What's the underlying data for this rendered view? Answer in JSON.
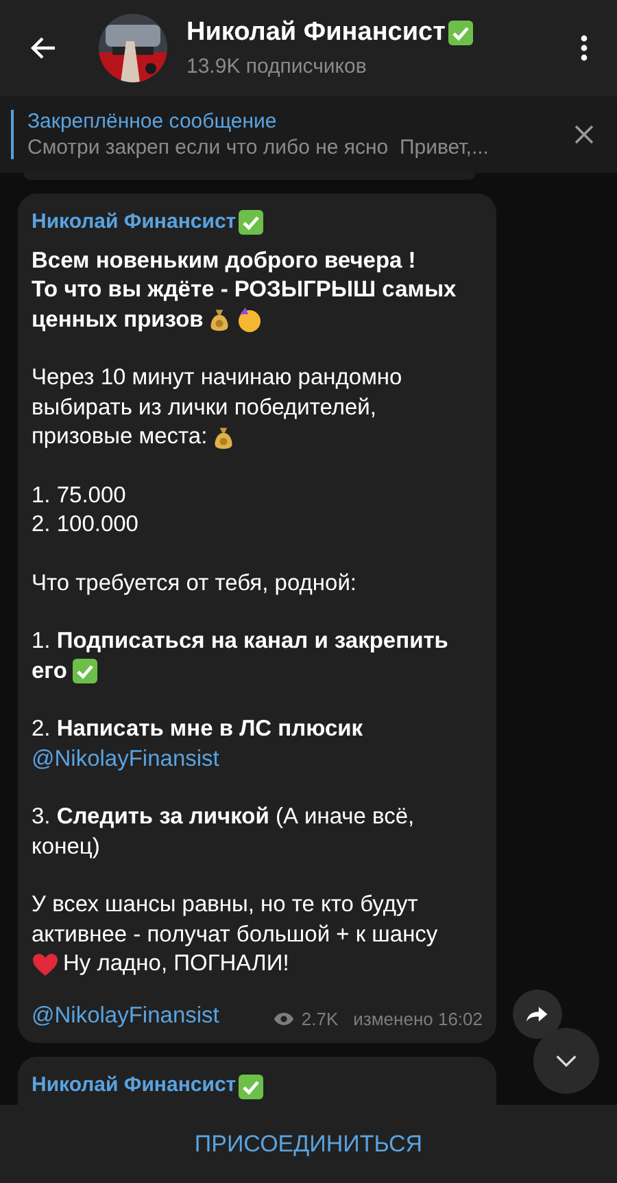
{
  "header": {
    "title": "Николай Финансист",
    "verified": true,
    "subtitle": "13.9K подписчиков"
  },
  "pinned": {
    "title": "Закреплённое сообщение",
    "text": "Смотри закреп если что либо не ясно  Привет,..."
  },
  "messages": [
    {
      "author": "Николай Финансист",
      "verified": true,
      "paragraphs": [
        [
          [
            {
              "kind": "text",
              "text": "Всем новеньким доброго вечера !\nТо что вы ждёте - РОЗЫГРЫШ самых",
              "bold": true
            }
          ],
          [
            {
              "kind": "text",
              "text": "ценных призов",
              "bold": true
            },
            {
              "kind": "moneybag"
            },
            {
              "kind": "party"
            }
          ]
        ],
        [
          [
            {
              "kind": "text",
              "text": "Через 10 минут начинаю рандомно\nвыбирать из лички победителей,",
              "bold": false
            }
          ],
          [
            {
              "kind": "text",
              "text": "призовые места:",
              "bold": false
            },
            {
              "kind": "moneybag"
            }
          ]
        ],
        [
          [
            {
              "kind": "text",
              "text": "1. 75.000\n2. 100.000",
              "bold": false
            }
          ]
        ],
        [
          [
            {
              "kind": "text",
              "text": "Что требуется от тебя, родной:",
              "bold": false
            }
          ]
        ],
        [
          [
            {
              "kind": "text",
              "text": "1. **Подписаться на канал и закрепить**",
              "bold": false
            }
          ],
          [
            {
              "kind": "text",
              "text": "его",
              "bold": true
            },
            {
              "kind": "check"
            }
          ]
        ],
        [
          [
            {
              "kind": "text",
              "text": "2. **Написать мне в ЛС плюсик**",
              "bold": false
            }
          ],
          [
            {
              "kind": "link",
              "text": "@NikolayFinansist"
            }
          ]
        ],
        [
          [
            {
              "kind": "text",
              "text": "3. **Следить за личкой** (А иначе всё,\nконец)",
              "bold": false
            }
          ]
        ],
        [
          [
            {
              "kind": "text",
              "text": "У всех шансы равны, но те кто будут\nактивнее - получат большой + к шансу",
              "bold": false
            }
          ],
          [
            {
              "kind": "heart"
            },
            {
              "kind": "text",
              "text": "Ну ладно, ПОГНАЛИ!",
              "bold": false
            }
          ]
        ]
      ],
      "signature": "@NikolayFinansist",
      "views": "2.7K",
      "time": "изменено 16:02"
    },
    {
      "author": "Николай Финансист",
      "verified": true
    }
  ],
  "join_button": "ПРИСОЕДИНИТЬСЯ"
}
